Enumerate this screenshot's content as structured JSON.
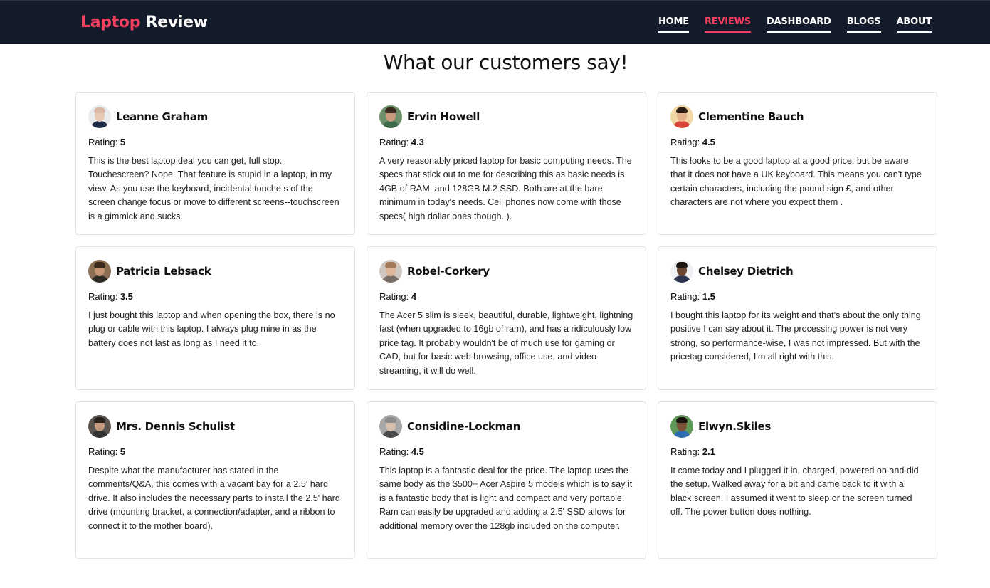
{
  "header": {
    "brand_accent": "Laptop",
    "brand_rest": "Review",
    "nav": [
      {
        "label": "HOME",
        "active": false
      },
      {
        "label": "REVIEWS",
        "active": true
      },
      {
        "label": "DASHBOARD",
        "active": false
      },
      {
        "label": "BLOGS",
        "active": false
      },
      {
        "label": "ABOUT",
        "active": false
      }
    ]
  },
  "colors": {
    "navbar_bg": "#141b2b",
    "accent": "#f43f5e"
  },
  "page": {
    "title": "What our customers say!"
  },
  "rating_label": "Rating:",
  "reviews": [
    {
      "name": "Leanne Graham",
      "rating": "5",
      "text": "This is the best laptop deal you can get, full stop. Touchescreen? Nope. That feature is stupid in a laptop, in my view. As you use the keyboard, incidental touche s of the screen change focus or move to different screens--touchscreen is a gimmick and sucks.",
      "avatar": {
        "skin": "#e8c8b4",
        "hair": "#d9b9a4",
        "shirt": "#1d2a44",
        "bg": "#e9ecef"
      }
    },
    {
      "name": "Ervin Howell",
      "rating": "4.3",
      "text": "A very reasonably priced laptop for basic computing needs. The specs that stick out to me for describing this as basic needs is 4GB of RAM, and 128GB M.2 SSD. Both are at the bare minimum in today's needs. Cell phones now come with those specs( high dollar ones though..).",
      "avatar": {
        "skin": "#c99a7c",
        "hair": "#3a2a20",
        "shirt": "#3f6a4a",
        "bg": "#6d8f6a"
      }
    },
    {
      "name": "Clementine Bauch",
      "rating": "4.5",
      "text": "This looks to be a good laptop at a good price, but be aware that it does not have a UK keyboard. This means you can't type certain characters, including the pound sign £, and other characters are not where you expect them .",
      "avatar": {
        "skin": "#e2b08a",
        "hair": "#2b1d14",
        "shirt": "#d8453b",
        "bg": "#f2d7a6"
      }
    },
    {
      "name": "Patricia Lebsack",
      "rating": "3.5",
      "text": "I just bought this laptop and when opening the box, there is no plug or cable with this laptop. I always plug mine in as the battery does not last as long as I need it to.",
      "avatar": {
        "skin": "#c89572",
        "hair": "#3b2a1c",
        "shirt": "#2e2a26",
        "bg": "#8a6f55"
      }
    },
    {
      "name": "Robel-Corkery",
      "rating": "4",
      "text": "The Acer 5 slim is sleek, beautiful, durable, lightweight, lightning fast (when upgraded to 16gb of ram), and has a ridiculously low price tag. It probably wouldn't be of much use for gaming or CAD, but for basic web browsing, office use, and video streaming, it will do well.",
      "avatar": {
        "skin": "#e0b69a",
        "hair": "#a47a58",
        "shirt": "#7a6e66",
        "bg": "#cfc7c0"
      }
    },
    {
      "name": "Chelsey Dietrich",
      "rating": "1.5",
      "text": "I bought this laptop for its weight and that's about the only thing positive I can say about it. The processing power is not very strong, so performance-wise, I was not impressed. But with the pricetag considered, I'm all right with this.",
      "avatar": {
        "skin": "#6a4632",
        "hair": "#1e1410",
        "shirt": "#2b3550",
        "bg": "#eef0f3"
      }
    },
    {
      "name": "Mrs. Dennis Schulist",
      "rating": "5",
      "text": "Despite what the manufacturer has stated in the comments/Q&A, this comes with a vacant bay for a 2.5' hard drive. It also includes the necessary parts to install the 2.5' hard drive (mounting bracket, a connection/adapter, and a ribbon to connect it to the mother board).",
      "avatar": {
        "skin": "#c49a7e",
        "hair": "#2a211c",
        "shirt": "#333333",
        "bg": "#5a5550"
      }
    },
    {
      "name": "Considine-Lockman",
      "rating": "4.5",
      "text": "This laptop is a fantastic deal for the price. The laptop uses the same body as the $500+ Acer Aspire 5 models which is to say it is a fantastic body that is light and compact and very portable. Ram can easily be upgraded and adding a 2.5' SSD allows for additional memory over the 128gb included on the computer.",
      "avatar": {
        "skin": "#d8c0ae",
        "hair": "#8c8c8c",
        "shirt": "#4a4a4a",
        "bg": "#a8a8a8"
      }
    },
    {
      "name": "Elwyn.Skiles",
      "rating": "2.1",
      "text": "It came today and I plugged it in, charged, powered on and did the setup. Walked away for a bit and came back to it with a black screen. I assumed it went to sleep or the screen turned off. The power button does nothing.",
      "avatar": {
        "skin": "#7a5238",
        "hair": "#1c1410",
        "shirt": "#2f6fb0",
        "bg": "#5f9a58"
      }
    }
  ]
}
